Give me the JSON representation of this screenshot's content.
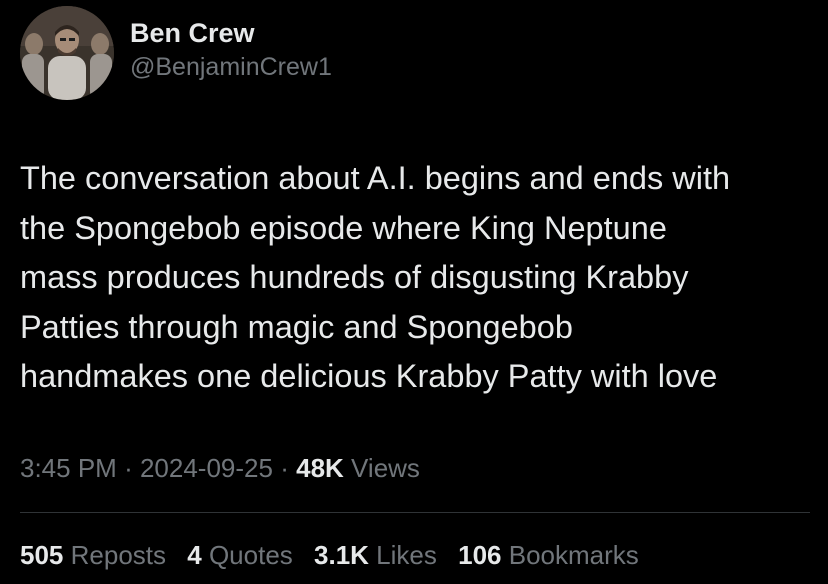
{
  "author": {
    "display_name": "Ben Crew",
    "handle": "@BenjaminCrew1"
  },
  "tweet": {
    "text": "The conversation about A.I. begins and ends with\nthe Spongebob episode where King Neptune\nmass produces hundreds of disgusting Krabby\nPatties through magic and Spongebob\nhandmakes one delicious Krabby Patty with love"
  },
  "meta": {
    "time": "3:45 PM",
    "sep1": "·",
    "date": "2024-09-25",
    "sep2": "·",
    "views_count": "48K",
    "views_label": "Views"
  },
  "stats": {
    "reposts": {
      "count": "505",
      "label": "Reposts"
    },
    "quotes": {
      "count": "4",
      "label": "Quotes"
    },
    "likes": {
      "count": "3.1K",
      "label": "Likes"
    },
    "bookmarks": {
      "count": "106",
      "label": "Bookmarks"
    }
  },
  "colors": {
    "background": "#000000",
    "primary_text": "#e7e9ea",
    "secondary_text": "#71767b",
    "divider": "#2f3336"
  }
}
